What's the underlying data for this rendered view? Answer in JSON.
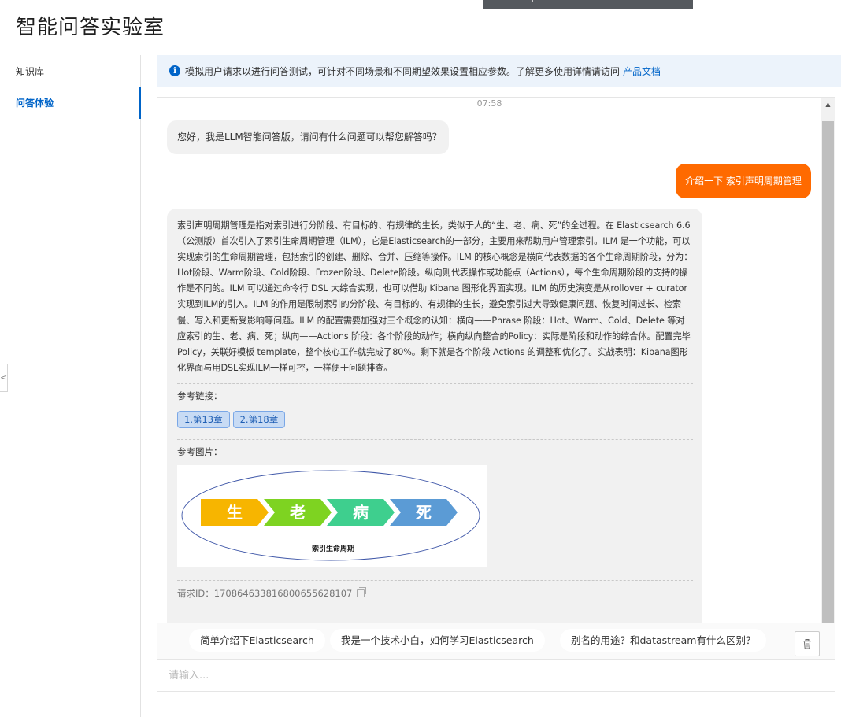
{
  "page": {
    "title": "智能问答实验室"
  },
  "sidebar": {
    "items": [
      {
        "label": "知识库",
        "active": false
      },
      {
        "label": "问答体验",
        "active": true
      }
    ]
  },
  "notice": {
    "text": "模拟用户请求以进行问答测试，可针对不同场景和不同期望效果设置相应参数。了解更多使用详情请访问",
    "link_text": "产品文档"
  },
  "chat": {
    "timestamp": "07:58",
    "greeting": "您好，我是LLM智能问答版，请问有什么问题可以帮您解答吗？",
    "user_message": "介绍一下 索引声明周期管理",
    "answer": {
      "text": "索引声明周期管理是指对索引进行分阶段、有目标的、有规律的生长，类似于人的“生、老、病、死”的全过程。在 Elasticsearch 6.6（公测版）首次引入了索引生命周期管理（ILM），它是Elasticsearch的一部分，主要用来帮助用户管理索引。ILM 是一个功能，可以实现索引的生命周期管理，包括索引的创建、删除、合并、压缩等操作。ILM 的核心概念是横向代表数据的各个生命周期阶段，分为：Hot阶段、Warm阶段、Cold阶段、Frozen阶段、Delete阶段。纵向则代表操作或功能点（Actions），每个生命周期阶段的支持的操作是不同的。ILM 可以通过命令行 DSL 大综合实现，也可以借助 Kibana 图形化界面实现。ILM 的历史演变是从rollover + curator 实现到ILM的引入。ILM 的作用是限制索引的分阶段、有目标的、有规律的生长，避免索引过大导致健康问题、恢复时间过长、检索慢、写入和更新受影响等问题。ILM 的配置需要加强对三个概念的认知：横向——Phrase 阶段：Hot、Warm、Cold、Delete 等对应索引的生、老、病、死；纵向——Actions 阶段：各个阶段的动作；横向纵向整合的Policy：实际是阶段和动作的综合体。配置完毕Policy，关联好模板 template，整个核心工作就完成了80%。剩下就是各个阶段 Actions 的调整和优化了。实战表明：Kibana图形化界面与用DSL实现ILM一样可控，一样便于问题排查。",
      "ref_links_label": "参考链接：",
      "ref_links": [
        "1.第13章",
        "2.第18章"
      ],
      "ref_images_label": "参考图片：",
      "diagram": {
        "stages": [
          "生",
          "老",
          "病",
          "死"
        ],
        "stage_colors": [
          "#f7b500",
          "#7ed321",
          "#3ecf8e",
          "#5b9bd5"
        ],
        "caption": "索引生命周期"
      },
      "request_id_label": "请求ID：",
      "request_id": "17086463381680065562810​7"
    }
  },
  "suggestions": [
    "简单介绍下Elasticsearch",
    "我是一个技术小白，如何学习Elasticsearch",
    "别名的用途？和datastream有什么区别？"
  ],
  "input": {
    "placeholder": "请输入..."
  }
}
